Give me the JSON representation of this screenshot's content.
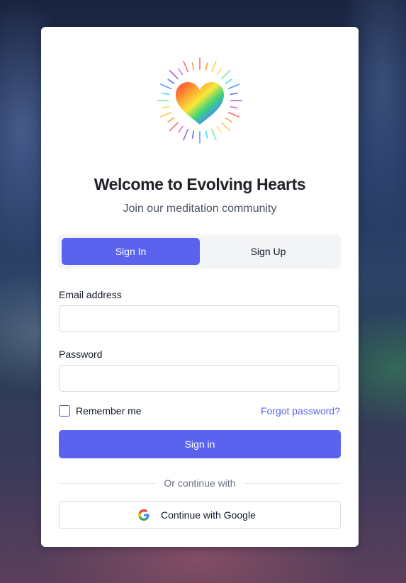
{
  "header": {
    "logo_icon": "rainbow-heart-icon",
    "title": "Welcome to Evolving Hearts",
    "subtitle": "Join our meditation community"
  },
  "tabs": [
    {
      "label": "Sign In",
      "active": true
    },
    {
      "label": "Sign Up",
      "active": false
    }
  ],
  "form": {
    "email_label": "Email address",
    "email_value": "",
    "password_label": "Password",
    "password_value": "",
    "remember_label": "Remember me",
    "remember_checked": false,
    "forgot_label": "Forgot password?",
    "submit_label": "Sign in"
  },
  "divider_text": "Or continue with",
  "social": {
    "google_label": "Continue with Google",
    "google_icon": "google-icon"
  },
  "colors": {
    "accent": "#5b63ee",
    "title": "#1f2328",
    "muted": "#6b7280"
  }
}
